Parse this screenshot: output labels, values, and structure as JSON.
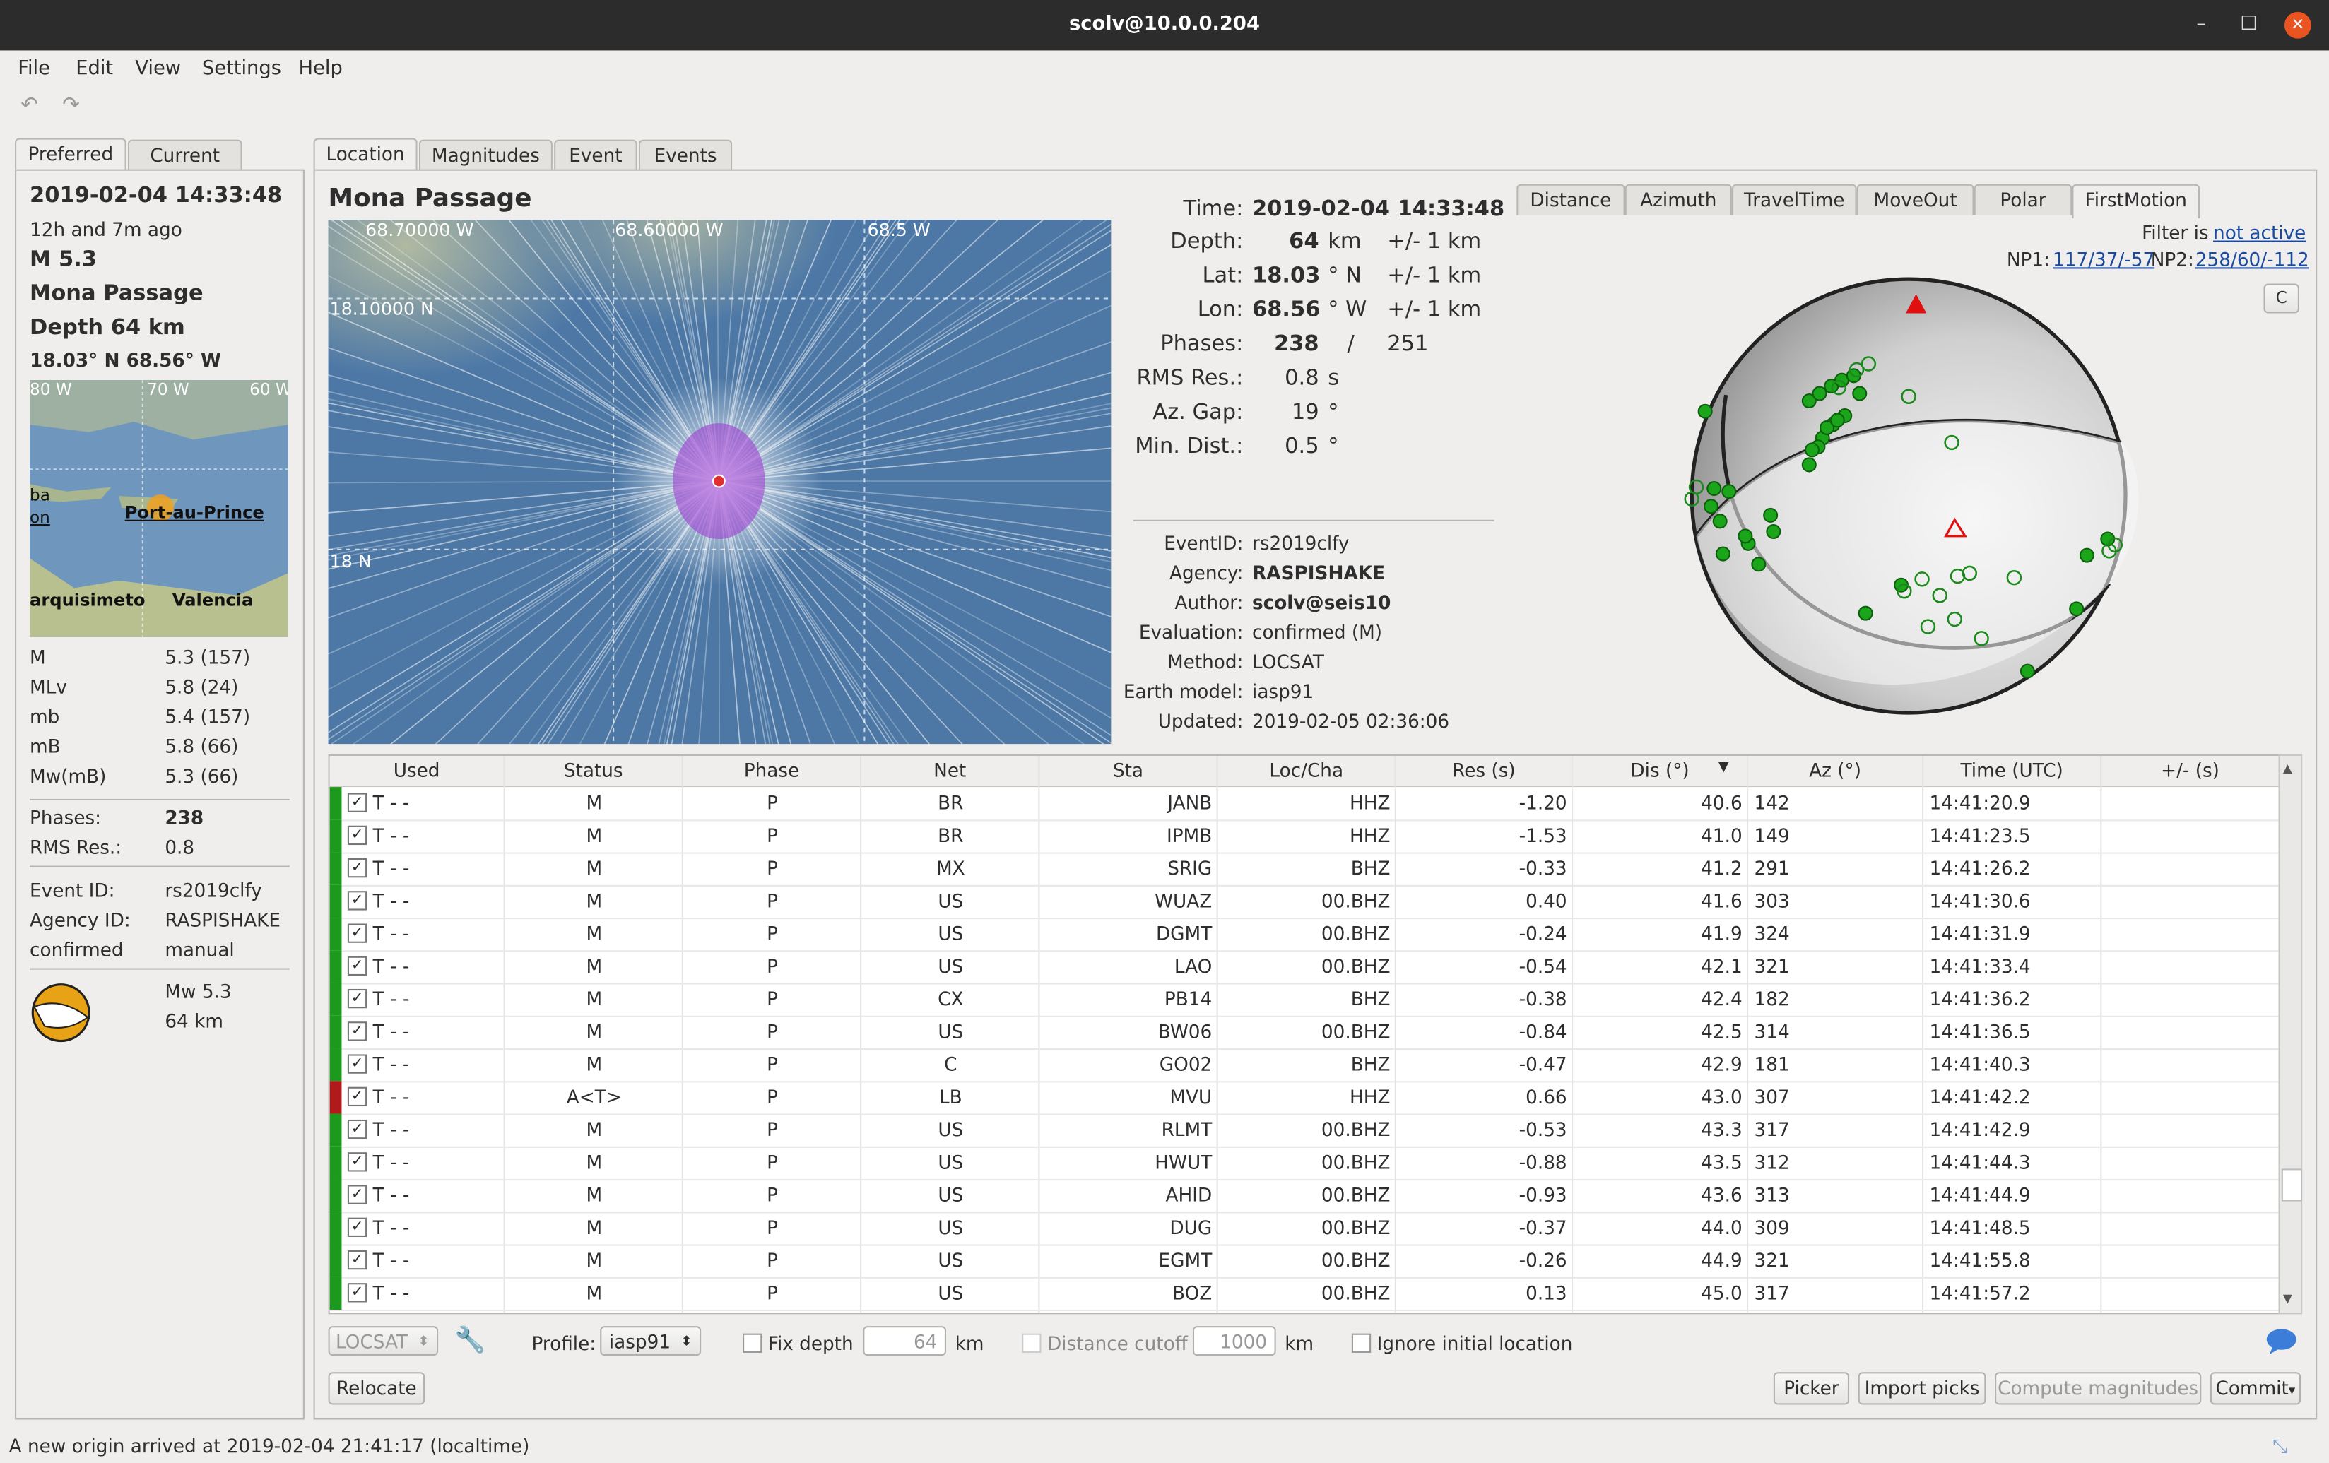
{
  "window": {
    "title": "scolv@10.0.0.204",
    "min": "–",
    "max": "☐",
    "close": "✕"
  },
  "menu": [
    "File",
    "Edit",
    "View",
    "Settings",
    "Help"
  ],
  "left": {
    "tabs": [
      "Preferred",
      "Current"
    ],
    "datetime": "2019-02-04 14:33:48",
    "ago": "12h and 7m ago",
    "magnitude": "M 5.3",
    "region": "Mona Passage",
    "depth": "Depth 64 km",
    "coords": "18.03° N  68.56° W",
    "map_labels": {
      "lon1": "80 W",
      "lon2": "70 W",
      "lon3": "60 W",
      "city1": "Port-au-Prince",
      "city2": "arquisimeto",
      "city3": "Valencia",
      "city4": "ba",
      "city5": "on"
    },
    "mags": [
      {
        "type": "M",
        "value": "5.3 (157)"
      },
      {
        "type": "MLv",
        "value": "5.8 (24)"
      },
      {
        "type": "mb",
        "value": "5.4 (157)"
      },
      {
        "type": "mB",
        "value": "5.8 (66)"
      },
      {
        "type": "Mw(mB)",
        "value": "5.3 (66)"
      }
    ],
    "phases_label": "Phases:",
    "phases_value": "238",
    "rms_label": "RMS Res.:",
    "rms_value": "0.8",
    "event_id_label": "Event ID:",
    "event_id": "rs2019clfy",
    "agency_label": "Agency ID:",
    "agency": "RASPISHAKE",
    "status": "confirmed",
    "mode": "manual",
    "fm_mag": "Mw 5.3",
    "fm_depth": "64 km"
  },
  "main_tabs": [
    "Location",
    "Magnitudes",
    "Event",
    "Events"
  ],
  "location": {
    "title": "Mona Passage",
    "map": {
      "lon1": "68.70000 W",
      "lon2": "68.60000 W",
      "lon3": "68.5 W",
      "lat1": "18.10000 N",
      "lat2": "18 N"
    },
    "time_label": "Time:",
    "time": "2019-02-04 14:33:48",
    "depth_label": "Depth:",
    "depth": "64",
    "depth_unit": "km",
    "depth_err": "+/- 1  km",
    "lat_label": "Lat:",
    "lat": "18.03",
    "lat_unit": "° N",
    "lat_err": "+/- 1  km",
    "lon_label": "Lon:",
    "lon": "68.56",
    "lon_unit": "° W",
    "lon_err": "+/- 1  km",
    "phases_label": "Phases:",
    "phases": "238",
    "phases_sep": "/",
    "phases_total": "251",
    "rms_label": "RMS Res.:",
    "rms": "0.8",
    "rms_unit": "s",
    "azgap_label": "Az. Gap:",
    "azgap": "19",
    "azgap_unit": "°",
    "mindist_label": "Min. Dist.:",
    "mindist": "0.5",
    "mindist_unit": "°",
    "eventid_label": "EventID:",
    "eventid": "rs2019clfy",
    "agency_label": "Agency:",
    "agency": "RASPISHAKE",
    "author_label": "Author:",
    "author": "scolv@seis10",
    "eval_label": "Evaluation:",
    "eval": "confirmed (M)",
    "method_label": "Method:",
    "method": "LOCSAT",
    "model_label": "Earth model:",
    "model": "iasp91",
    "updated_label": "Updated:",
    "updated": "2019-02-05 02:36:06"
  },
  "plot_tabs": [
    "Distance",
    "Azimuth",
    "TravelTime",
    "MoveOut",
    "Polar",
    "FirstMotion"
  ],
  "filter": {
    "prefix": "Filter is",
    "state": "not active"
  },
  "np": {
    "np1_label": "NP1:",
    "np1": "117/37/-57",
    "np2_label": "NP2:",
    "np2": "258/60/-112",
    "menu": "C"
  },
  "table": {
    "headers": [
      "Used",
      "Status",
      "Phase",
      "Net",
      "Sta",
      "Loc/Cha",
      "Res (s)",
      "Dis (°)",
      "Az (°)",
      "Time (UTC)",
      "+/- (s)"
    ],
    "rows": [
      {
        "used": "T  -  -",
        "status": "M",
        "phase": "P",
        "net": "BR",
        "sta": "JANB",
        "loccha": "HHZ",
        "res": "-1.20",
        "dis": "40.6",
        "az": "142",
        "time": "14:41:20.9",
        "ok": true
      },
      {
        "used": "T  -  -",
        "status": "M",
        "phase": "P",
        "net": "BR",
        "sta": "IPMB",
        "loccha": "HHZ",
        "res": "-1.53",
        "dis": "41.0",
        "az": "149",
        "time": "14:41:23.5",
        "ok": true
      },
      {
        "used": "T  -  -",
        "status": "M",
        "phase": "P",
        "net": "MX",
        "sta": "SRIG",
        "loccha": "BHZ",
        "res": "-0.33",
        "dis": "41.2",
        "az": "291",
        "time": "14:41:26.2",
        "ok": true
      },
      {
        "used": "T  -  -",
        "status": "M",
        "phase": "P",
        "net": "US",
        "sta": "WUAZ",
        "loccha": "00.BHZ",
        "res": "0.40",
        "dis": "41.6",
        "az": "303",
        "time": "14:41:30.6",
        "ok": true
      },
      {
        "used": "T  -  -",
        "status": "M",
        "phase": "P",
        "net": "US",
        "sta": "DGMT",
        "loccha": "00.BHZ",
        "res": "-0.24",
        "dis": "41.9",
        "az": "324",
        "time": "14:41:31.9",
        "ok": true
      },
      {
        "used": "T  -  -",
        "status": "M",
        "phase": "P",
        "net": "US",
        "sta": "LAO",
        "loccha": "00.BHZ",
        "res": "-0.54",
        "dis": "42.1",
        "az": "321",
        "time": "14:41:33.4",
        "ok": true
      },
      {
        "used": "T  -  -",
        "status": "M",
        "phase": "P",
        "net": "CX",
        "sta": "PB14",
        "loccha": "BHZ",
        "res": "-0.38",
        "dis": "42.4",
        "az": "182",
        "time": "14:41:36.2",
        "ok": true
      },
      {
        "used": "T  -  -",
        "status": "M",
        "phase": "P",
        "net": "US",
        "sta": "BW06",
        "loccha": "00.BHZ",
        "res": "-0.84",
        "dis": "42.5",
        "az": "314",
        "time": "14:41:36.5",
        "ok": true
      },
      {
        "used": "T  -  -",
        "status": "M",
        "phase": "P",
        "net": "C",
        "sta": "GO02",
        "loccha": "BHZ",
        "res": "-0.47",
        "dis": "42.9",
        "az": "181",
        "time": "14:41:40.3",
        "ok": true
      },
      {
        "used": "T  -  -",
        "status": "A<T>",
        "phase": "P",
        "net": "LB",
        "sta": "MVU",
        "loccha": "HHZ",
        "res": "0.66",
        "dis": "43.0",
        "az": "307",
        "time": "14:41:42.2",
        "ok": false
      },
      {
        "used": "T  -  -",
        "status": "M",
        "phase": "P",
        "net": "US",
        "sta": "RLMT",
        "loccha": "00.BHZ",
        "res": "-0.53",
        "dis": "43.3",
        "az": "317",
        "time": "14:41:42.9",
        "ok": true
      },
      {
        "used": "T  -  -",
        "status": "M",
        "phase": "P",
        "net": "US",
        "sta": "HWUT",
        "loccha": "00.BHZ",
        "res": "-0.88",
        "dis": "43.5",
        "az": "312",
        "time": "14:41:44.3",
        "ok": true
      },
      {
        "used": "T  -  -",
        "status": "M",
        "phase": "P",
        "net": "US",
        "sta": "AHID",
        "loccha": "00.BHZ",
        "res": "-0.93",
        "dis": "43.6",
        "az": "313",
        "time": "14:41:44.9",
        "ok": true
      },
      {
        "used": "T  -  -",
        "status": "M",
        "phase": "P",
        "net": "US",
        "sta": "DUG",
        "loccha": "00.BHZ",
        "res": "-0.37",
        "dis": "44.0",
        "az": "309",
        "time": "14:41:48.5",
        "ok": true
      },
      {
        "used": "T  -  -",
        "status": "M",
        "phase": "P",
        "net": "US",
        "sta": "EGMT",
        "loccha": "00.BHZ",
        "res": "-0.26",
        "dis": "44.9",
        "az": "321",
        "time": "14:41:55.8",
        "ok": true
      },
      {
        "used": "T  -  -",
        "status": "M",
        "phase": "P",
        "net": "US",
        "sta": "BOZ",
        "loccha": "00.BHZ",
        "res": "0.13",
        "dis": "45.0",
        "az": "317",
        "time": "14:41:57.2",
        "ok": true
      }
    ]
  },
  "controls": {
    "locator": "LOCSAT",
    "profile_label": "Profile:",
    "profile": "iasp91",
    "fixdepth_label": "Fix depth",
    "fixdepth_value": "64",
    "km1": "km",
    "distcut_label": "Distance cutoff",
    "distcut_value": "1000",
    "km2": "km",
    "ignore_label": "Ignore initial location",
    "relocate": "Relocate",
    "picker": "Picker",
    "import": "Import picks",
    "compute": "Compute magnitudes",
    "commit": "Commit"
  },
  "statusbar": "A new origin arrived at 2019-02-04 21:41:17 (localtime)",
  "colors": {
    "ok": "#1d9a1d",
    "bad": "#b01a1a",
    "accent": "#e95420"
  }
}
